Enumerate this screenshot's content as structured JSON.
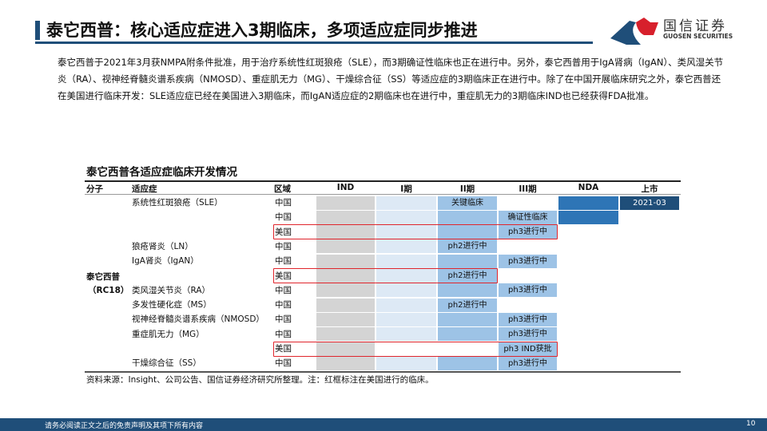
{
  "header": {
    "title": "泰它西普：核心适应症进入3期临床，多项适应症同步推进",
    "logo_cn": "国信证券",
    "logo_en": "GUOSEN SECURITIES"
  },
  "paragraph": "泰它西普于2021年3月获NMPA附条件批准，用于治疗系统性红斑狼疮（SLE），而3期确证性临床也正在进行中。另外，泰它西普用于IgA肾病（IgAN）、类风湿关节炎（RA）、视神经脊髓炎谱系疾病（NMOSD）、重症肌无力（MG）、干燥综合征（SS）等适应症的3期临床正在进行中。除了在中国开展临床研究之外，泰它西普还在美国进行临床开发：SLE适应症已经在美国进入3期临床，而IgAN适应症的2期临床也在进行中，重症肌无力的3期临床IND也已经获得FDA批准。",
  "table": {
    "title": "泰它西普各适应症临床开发情况",
    "headers": [
      "分子",
      "适应症",
      "区域",
      "IND",
      "I期",
      "II期",
      "III期",
      "NDA",
      "上市"
    ],
    "molecule": [
      "泰它西普",
      "（RC18）"
    ],
    "colors": {
      "ind": "#d4d4d4",
      "p1": "#dde9f5",
      "p2": "#9dc3e6",
      "p3": "#9dc3e6",
      "nda": "#2e75b6",
      "mkt": "#1f4e79",
      "none": "#ffffff"
    },
    "rows": [
      {
        "indication": "系统性红斑狼疮（SLE）",
        "region": "中国",
        "us": false,
        "fills": [
          "ind",
          "p1",
          "p2",
          "none",
          "nda",
          "mkt"
        ],
        "labels": [
          "",
          "",
          "关键临床",
          "",
          "",
          "2021-03"
        ]
      },
      {
        "indication": "",
        "region": "中国",
        "us": false,
        "fills": [
          "ind",
          "p1",
          "p2",
          "p3",
          "nda",
          ""
        ],
        "labels": [
          "",
          "",
          "",
          "确证性临床",
          "",
          ""
        ]
      },
      {
        "indication": "",
        "region": "美国",
        "us": true,
        "fills": [
          "ind",
          "p1",
          "p2",
          "p3",
          "",
          ""
        ],
        "labels": [
          "",
          "",
          "",
          "ph3进行中",
          "",
          ""
        ]
      },
      {
        "indication": "狼疮肾炎（LN）",
        "region": "中国",
        "us": false,
        "fills": [
          "ind",
          "p1",
          "p2",
          "",
          "",
          ""
        ],
        "labels": [
          "",
          "",
          "ph2进行中",
          "",
          "",
          ""
        ]
      },
      {
        "indication": "IgA肾炎（IgAN）",
        "region": "中国",
        "us": false,
        "fills": [
          "ind",
          "p1",
          "p2",
          "p3",
          "",
          ""
        ],
        "labels": [
          "",
          "",
          "",
          "ph3进行中",
          "",
          ""
        ]
      },
      {
        "indication": "",
        "region": "美国",
        "us": true,
        "fills": [
          "ind",
          "p1",
          "p2",
          "",
          "",
          ""
        ],
        "labels": [
          "",
          "",
          "ph2进行中",
          "",
          "",
          ""
        ]
      },
      {
        "indication": "类风湿关节炎（RA）",
        "region": "中国",
        "us": false,
        "fills": [
          "ind",
          "p1",
          "p2",
          "p3",
          "",
          ""
        ],
        "labels": [
          "",
          "",
          "",
          "ph3进行中",
          "",
          ""
        ]
      },
      {
        "indication": "多发性硬化症（MS）",
        "region": "中国",
        "us": false,
        "fills": [
          "ind",
          "p1",
          "p2",
          "",
          "",
          ""
        ],
        "labels": [
          "",
          "",
          "ph2进行中",
          "",
          "",
          ""
        ]
      },
      {
        "indication": "视神经脊髓炎谱系疾病（NMOSD）",
        "region": "中国",
        "us": false,
        "fills": [
          "ind",
          "p1",
          "p2",
          "p3",
          "",
          ""
        ],
        "labels": [
          "",
          "",
          "",
          "ph3进行中",
          "",
          ""
        ]
      },
      {
        "indication": "重症肌无力（MG）",
        "region": "中国",
        "us": false,
        "fills": [
          "ind",
          "p1",
          "p2",
          "p3",
          "",
          ""
        ],
        "labels": [
          "",
          "",
          "",
          "ph3进行中",
          "",
          ""
        ]
      },
      {
        "indication": "",
        "region": "美国",
        "us": true,
        "fills": [
          "ind",
          "none",
          "none",
          "p3",
          "",
          ""
        ],
        "labels": [
          "",
          "",
          "",
          "ph3 IND获批",
          "",
          ""
        ]
      },
      {
        "indication": "干燥综合征（SS）",
        "region": "中国",
        "us": false,
        "fills": [
          "ind",
          "p1",
          "p2",
          "p3",
          "",
          ""
        ],
        "labels": [
          "",
          "",
          "",
          "ph3进行中",
          "",
          ""
        ]
      }
    ],
    "source": "资料来源：Insight、公司公告、国信证券经济研究所整理。注：红框标注在美国进行的临床。"
  },
  "footer": {
    "disclaimer": "请务必阅读正文之后的免责声明及其项下所有内容",
    "page": "10"
  }
}
